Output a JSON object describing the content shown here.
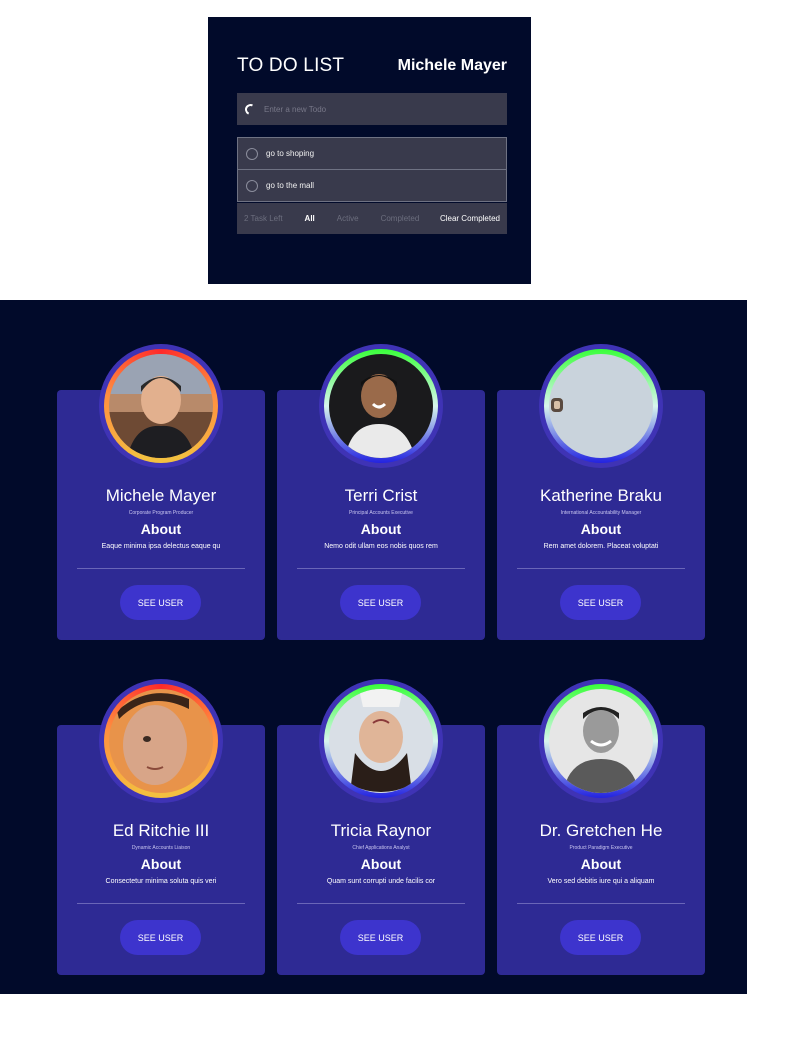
{
  "todo": {
    "title": "TO DO LIST",
    "user_name": "Michele Mayer",
    "input_placeholder": "Enter a new Todo",
    "items": [
      {
        "text": "go to shoping"
      },
      {
        "text": "go to the mall"
      }
    ],
    "footer": {
      "tasks_left": "2 Task Left",
      "filter_all": "All",
      "filter_active": "Active",
      "filter_completed": "Completed",
      "clear_completed": "Clear Completed"
    }
  },
  "users": [
    {
      "name": "Michele Mayer",
      "role": "Corporate Program Producer",
      "about_label": "About",
      "about": "Eaque minima ipsa delectus eaque qu",
      "button": "SEE USER",
      "ring": "warm"
    },
    {
      "name": "Terri Crist",
      "role": "Principal Accounts Executive",
      "about_label": "About",
      "about": "Nemo odit ullam eos nobis quos rem",
      "button": "SEE USER",
      "ring": "cool"
    },
    {
      "name": "Katherine Braku",
      "role": "International Accountability Manager",
      "about_label": "About",
      "about": "Rem amet dolorem. Placeat voluptati",
      "button": "SEE USER",
      "ring": "cool"
    },
    {
      "name": "Ed Ritchie III",
      "role": "Dynamic Accounts Liaison",
      "about_label": "About",
      "about": "Consectetur minima soluta quis veri",
      "button": "SEE USER",
      "ring": "warm"
    },
    {
      "name": "Tricia Raynor",
      "role": "Chief Applications Analyst",
      "about_label": "About",
      "about": "Quam sunt corrupti unde facilis cor",
      "button": "SEE USER",
      "ring": "cool"
    },
    {
      "name": "Dr. Gretchen He",
      "role": "Product Paradigm Executive",
      "about_label": "About",
      "about": "Vero sed debitis iure qui a aliquam",
      "button": "SEE USER",
      "ring": "cool"
    }
  ],
  "colors": {
    "background": "#010a2a",
    "card": "#2e2a94",
    "button": "#3d34cd",
    "panel": "#393a4c"
  }
}
